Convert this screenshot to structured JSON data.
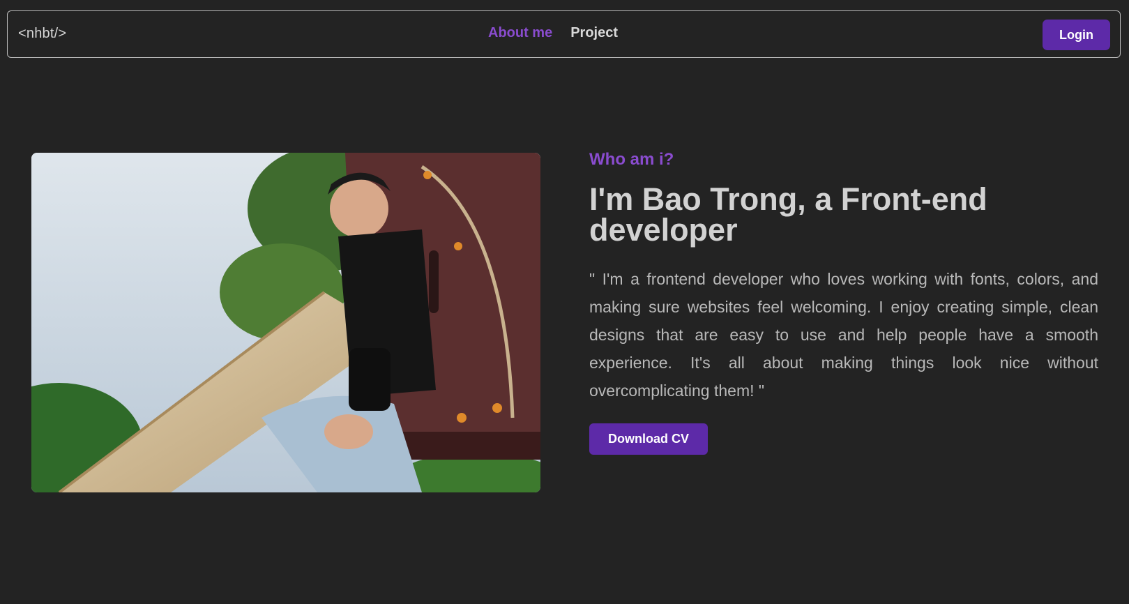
{
  "navbar": {
    "logo": "<nhbt/>",
    "links": [
      {
        "label": "About me",
        "active": true
      },
      {
        "label": "Project",
        "active": false
      }
    ],
    "login_label": "Login"
  },
  "hero": {
    "eyebrow": "Who am i?",
    "headline": "I'm Bao Trong, a Front-end developer",
    "bio": "\" I'm a frontend developer who loves working with fonts, colors, and making sure websites feel welcoming. I enjoy creating simple, clean designs that are easy to use and help people have a smooth experience. It's all about making things look nice without overcomplicating them! \"",
    "cv_button_label": "Download CV"
  },
  "colors": {
    "background": "#232323",
    "accent": "#8a4ccf",
    "button": "#5d2aa8"
  }
}
